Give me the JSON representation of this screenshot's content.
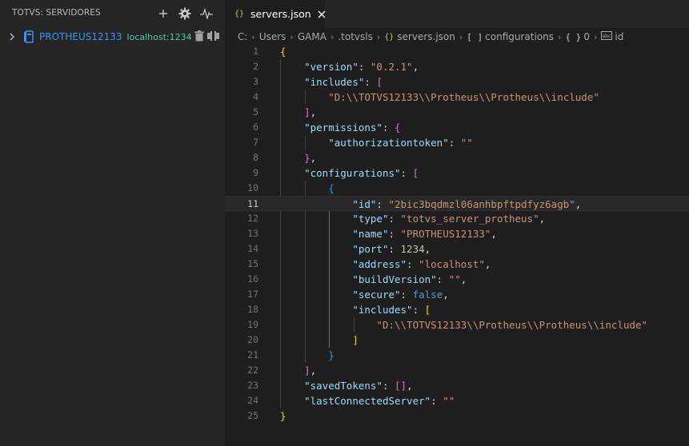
{
  "sidebar": {
    "title": "TOTVS: SERVIDORES",
    "actions": [
      "add-icon",
      "gear-icon",
      "pulse-icon"
    ],
    "server": {
      "name": "PROTHEUS12133",
      "address": "localhost:1234"
    }
  },
  "editor": {
    "tab": {
      "icon": "{}",
      "label": "servers.json"
    },
    "breadcrumb": {
      "drive": "C:",
      "folder1": "Users",
      "folder2": "GAMA",
      "folder3": ".totvsls",
      "file_icon": "{}",
      "file": "servers.json",
      "array_icon": "[ ]",
      "array": "configurations",
      "object_icon": "{ }",
      "index": "0",
      "field_icon": "abc",
      "field": "id"
    },
    "current_line": 11,
    "lines": [
      {
        "n": "1"
      },
      {
        "n": "2"
      },
      {
        "n": "3"
      },
      {
        "n": "4"
      },
      {
        "n": "5"
      },
      {
        "n": "6"
      },
      {
        "n": "7"
      },
      {
        "n": "8"
      },
      {
        "n": "9"
      },
      {
        "n": "10"
      },
      {
        "n": "11"
      },
      {
        "n": "12"
      },
      {
        "n": "13"
      },
      {
        "n": "14"
      },
      {
        "n": "15"
      },
      {
        "n": "16"
      },
      {
        "n": "17"
      },
      {
        "n": "18"
      },
      {
        "n": "19"
      },
      {
        "n": "20"
      },
      {
        "n": "21"
      },
      {
        "n": "22"
      },
      {
        "n": "23"
      },
      {
        "n": "24"
      },
      {
        "n": "25"
      }
    ],
    "json": {
      "k_version": "\"version\"",
      "v_version": "\"0.2.1\"",
      "k_includes": "\"includes\"",
      "v_include_path": "\"D:\\\\TOTVS12133\\\\Protheus\\\\Protheus\\\\include\"",
      "k_permissions": "\"permissions\"",
      "k_authorizationtoken": "\"authorizationtoken\"",
      "v_empty": "\"\"",
      "k_configurations": "\"configurations\"",
      "k_id": "\"id\"",
      "v_id": "\"2bic3bqdmzl06anhbpftpdfyz6agb\"",
      "k_type": "\"type\"",
      "v_type": "\"totvs_server_protheus\"",
      "k_name": "\"name\"",
      "v_name": "\"PROTHEUS12133\"",
      "k_port": "\"port\"",
      "v_port": "1234",
      "k_address": "\"address\"",
      "v_address": "\"localhost\"",
      "k_buildVersion": "\"buildVersion\"",
      "k_secure": "\"secure\"",
      "v_secure": "false",
      "k_savedTokens": "\"savedTokens\"",
      "k_lastConnectedServer": "\"lastConnectedServer\""
    }
  },
  "colors": {
    "background": "#1e1e1e",
    "sidebar": "#252526",
    "key": "#9cdcfe",
    "string": "#ce9178",
    "number": "#b5cea8",
    "keyword": "#569cd6",
    "server_name": "#3794ff",
    "server_address": "#4ec9b0"
  }
}
